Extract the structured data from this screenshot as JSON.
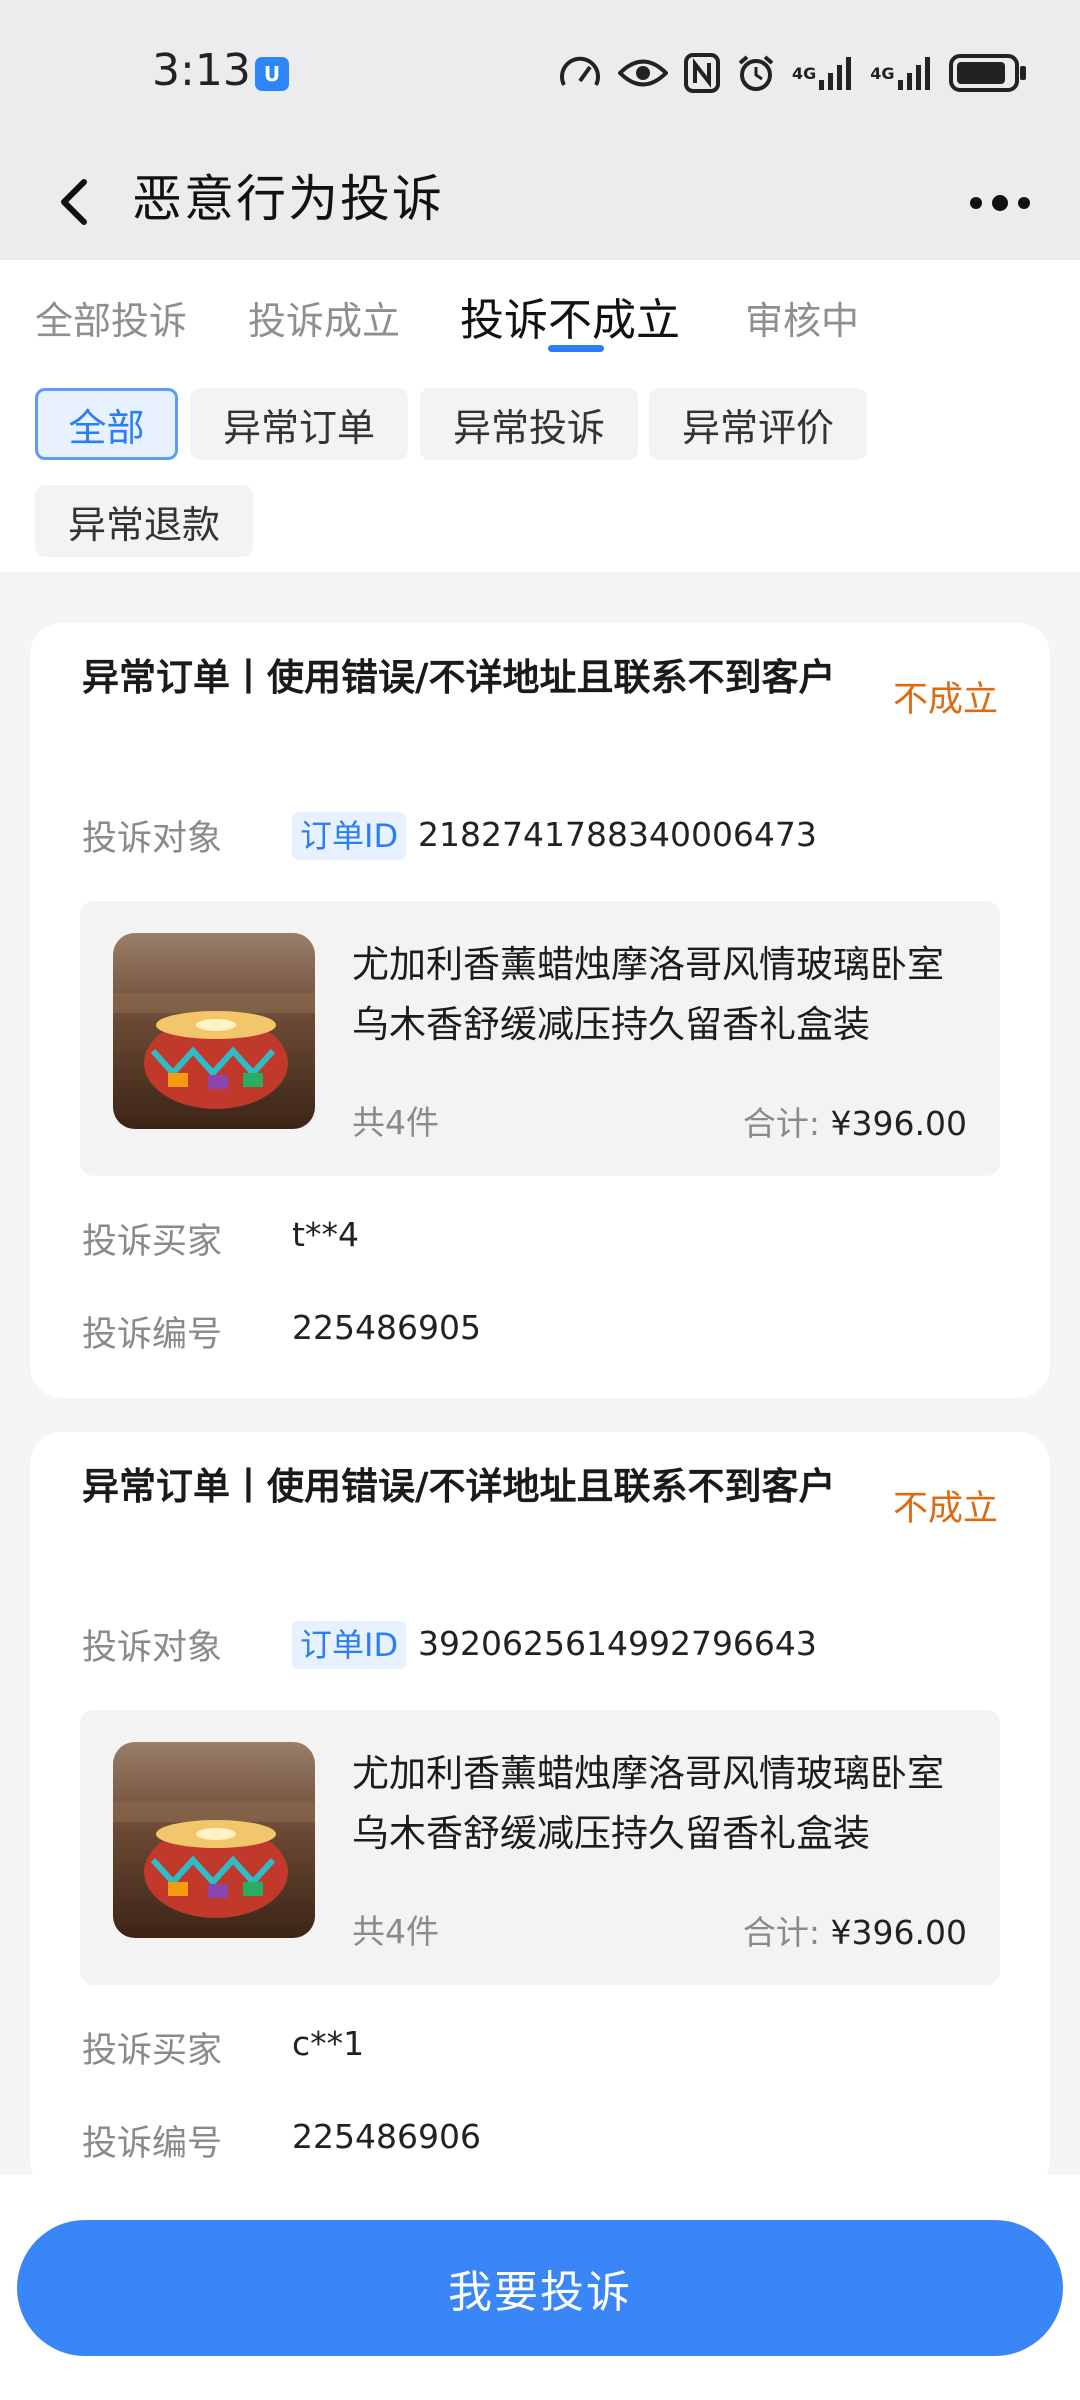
{
  "status_bar": {
    "time": "3:13",
    "badge": "U",
    "network_1": "4G",
    "network_2": "4G"
  },
  "header": {
    "title": "恶意行为投诉"
  },
  "tabs": [
    {
      "label": "全部投诉"
    },
    {
      "label": "投诉成立"
    },
    {
      "label": "投诉不成立"
    },
    {
      "label": "审核中"
    }
  ],
  "active_tab": "投诉不成立",
  "filters": [
    {
      "label": "全部"
    },
    {
      "label": "异常订单"
    },
    {
      "label": "异常投诉"
    },
    {
      "label": "异常评价"
    },
    {
      "label": "异常退款"
    }
  ],
  "active_filter": "全部",
  "complaints": [
    {
      "title": "异常订单丨使用错误/不详地址且联系不到客户",
      "status": "不成立",
      "target_label": "投诉对象",
      "order_tag": "订单ID",
      "order_id": "2182741788340006473",
      "product": {
        "name": "尤加利香薰蜡烛摩洛哥风情玻璃卧室乌木香舒缓减压持久留香礼盒装",
        "qty": "共4件",
        "total_label": "合计:",
        "total": "¥396.00"
      },
      "buyer_label": "投诉买家",
      "buyer": "t**4",
      "number_label": "投诉编号",
      "number": "225486905"
    },
    {
      "title": "异常订单丨使用错误/不详地址且联系不到客户",
      "status": "不成立",
      "target_label": "投诉对象",
      "order_tag": "订单ID",
      "order_id": "3920625614992796643",
      "product": {
        "name": "尤加利香薰蜡烛摩洛哥风情玻璃卧室乌木香舒缓减压持久留香礼盒装",
        "qty": "共4件",
        "total_label": "合计:",
        "total": "¥396.00"
      },
      "buyer_label": "投诉买家",
      "buyer": "c**1",
      "number_label": "投诉编号",
      "number": "225486906"
    }
  ],
  "bottom_button": {
    "label": "我要投诉"
  },
  "colors": {
    "accent": "#2b7ef5",
    "status_rejected": "#e06a10",
    "button": "#3a86f7"
  }
}
